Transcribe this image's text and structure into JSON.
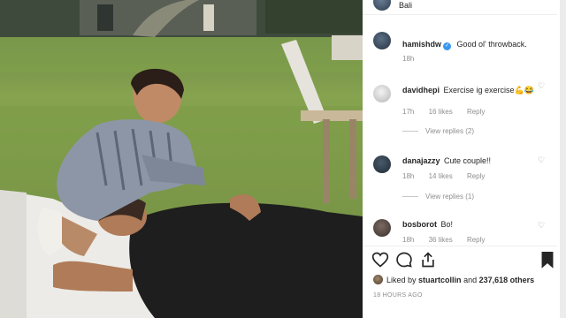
{
  "post": {
    "location": "Bali",
    "caption": {
      "username": "hamishdw",
      "text": "Good ol' throwback.",
      "age": "18h"
    }
  },
  "comments": [
    {
      "username": "davidhepi",
      "text": "Exercise ig exercise💪😂",
      "age": "17h",
      "likes": "16 likes",
      "reply": "Reply",
      "view_replies": "View replies (2)"
    },
    {
      "username": "danajazzy",
      "text": "Cute couple!!",
      "age": "18h",
      "likes": "14 likes",
      "reply": "Reply",
      "view_replies": "View replies (1)"
    },
    {
      "username": "bosborot",
      "text": "Bo!",
      "age": "18h",
      "likes": "36 likes",
      "reply": "Reply"
    }
  ],
  "likes_summary": {
    "prefix": "Liked by",
    "user": "stuartcollin",
    "and": "and",
    "others": "237,618 others"
  },
  "timestamp": "18 HOURS AGO",
  "icons": {
    "like": "heart-outline-icon",
    "comment": "comment-bubble-icon",
    "share": "share-icon",
    "save": "bookmark-icon",
    "verified": "verified-badge-icon",
    "comment_like": "heart-small-icon"
  },
  "colors": {
    "text": "#262626",
    "muted": "#8e8e8e",
    "verified": "#3897f0",
    "divider": "#efefef"
  }
}
